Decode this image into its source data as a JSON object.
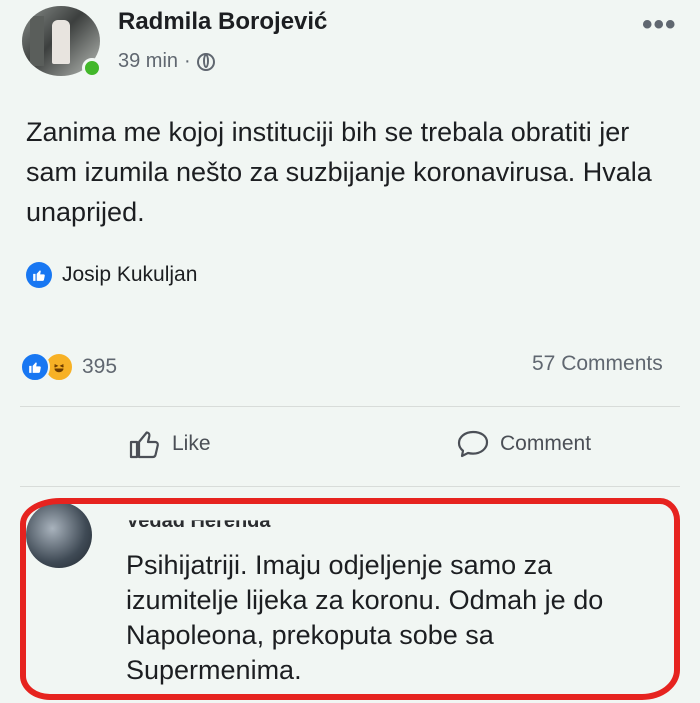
{
  "post": {
    "author": "Radmila Borojević",
    "time": "39 min",
    "separator": "·",
    "more_label": "•••",
    "text": "Zanima me kojoj instituciji bih se trebala obratiti jer sam izumila nešto za suzbijanje koronavirusa. Hvala unaprijed.",
    "shared_by": "Josip Kukuljan",
    "reactions_count": "395",
    "comments_count": "57 Comments"
  },
  "actions": {
    "like_label": "Like",
    "comment_label": "Comment"
  },
  "comment": {
    "author": "Vedad Herenda",
    "text": "Psihijatriji. Imaju odjeljenje samo za izumitelje lijeka za koronu. Odmah je do Napoleona, prekoputa sobe sa Supermenima."
  },
  "icons": {
    "globe": "globe-icon",
    "like_reaction": "like-reaction-icon",
    "haha_reaction": "haha-reaction-icon",
    "like": "thumbs-up-icon",
    "comment": "speech-bubble-icon"
  },
  "colors": {
    "background": "#f1f6f3",
    "facebook_blue": "#1877f2",
    "online_green": "#42b72a",
    "highlight_red": "#e6231f"
  }
}
